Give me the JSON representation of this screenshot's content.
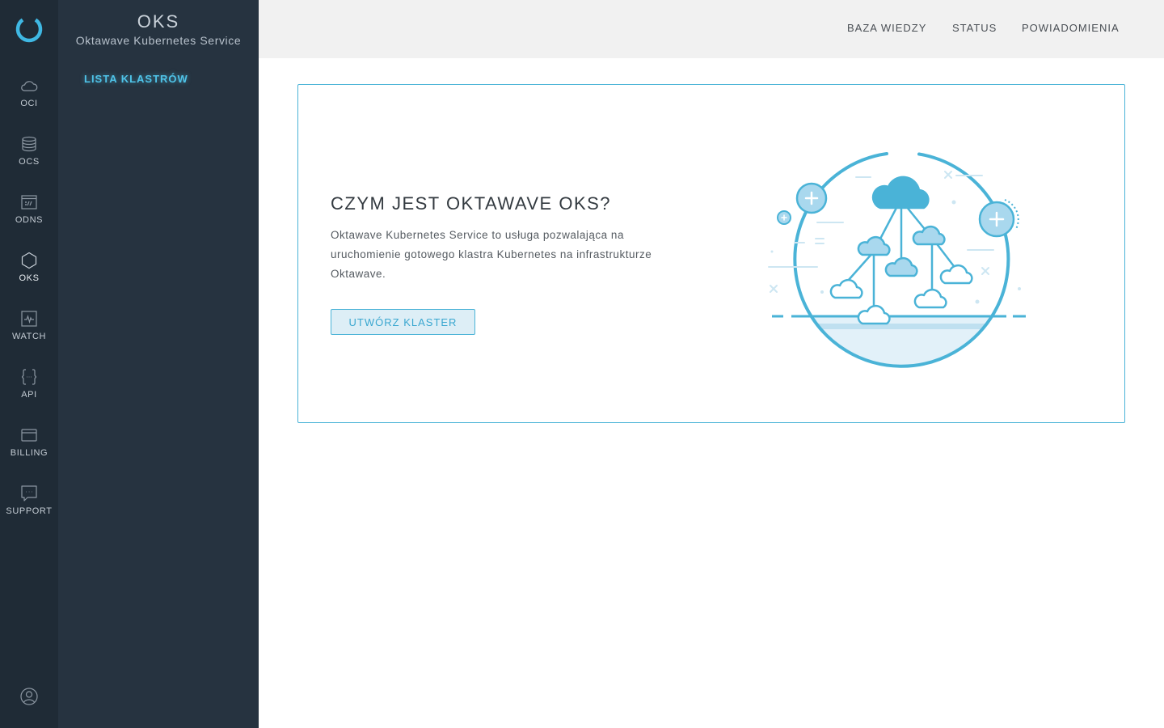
{
  "rail": {
    "items": [
      {
        "id": "oci",
        "label": "OCI",
        "icon": "cloud-icon"
      },
      {
        "id": "ocs",
        "label": "OCS",
        "icon": "database-icon"
      },
      {
        "id": "odns",
        "label": "ODNS",
        "icon": "dns-icon"
      },
      {
        "id": "oks",
        "label": "OKS",
        "icon": "hexagon-icon"
      },
      {
        "id": "watch",
        "label": "WATCH",
        "icon": "monitor-pulse-icon"
      },
      {
        "id": "api",
        "label": "API",
        "icon": "braces-icon"
      },
      {
        "id": "billing",
        "label": "BILLING",
        "icon": "credit-card-icon"
      },
      {
        "id": "support",
        "label": "SUPPORT",
        "icon": "chat-icon"
      }
    ],
    "active": "oks"
  },
  "sidebar": {
    "title": "OKS",
    "subtitle": "Oktawave Kubernetes Service",
    "link": "LISTA KLASTRÓW"
  },
  "topbar": {
    "links": [
      "BAZA WIEDZY",
      "STATUS",
      "POWIADOMIENIA"
    ]
  },
  "card": {
    "title": "CZYM JEST OKTAWAVE OKS?",
    "text": "Oktawave Kubernetes Service to usługa pozwalająca na uruchomienie gotowego klastra Kubernetes na infrastrukturze Oktawave.",
    "button": "UTWÓRZ KLASTER"
  },
  "colors": {
    "rail_bg": "#1f2b36",
    "sidebar_bg": "#263340",
    "accent": "#4ab3d7",
    "topbar_bg": "#f1f1f1"
  }
}
